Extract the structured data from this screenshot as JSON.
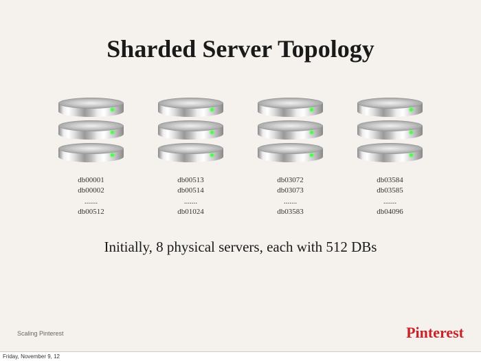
{
  "title": "Sharded Server Topology",
  "servers": [
    {
      "line1": "db00001",
      "line2": "db00002",
      "ellipsis": ".......",
      "line4": "db00512"
    },
    {
      "line1": "db00513",
      "line2": "db00514",
      "ellipsis": ".......",
      "line4": "db01024"
    },
    {
      "line1": "db03072",
      "line2": "db03073",
      "ellipsis": ".......",
      "line4": "db03583"
    },
    {
      "line1": "db03584",
      "line2": "db03585",
      "ellipsis": ".......",
      "line4": "db04096"
    }
  ],
  "subtitle": "Initially, 8 physical servers, each with 512 DBs",
  "footer_left": "Scaling Pinterest",
  "footer_right": "Pinterest",
  "date": "Friday, November 9, 12"
}
